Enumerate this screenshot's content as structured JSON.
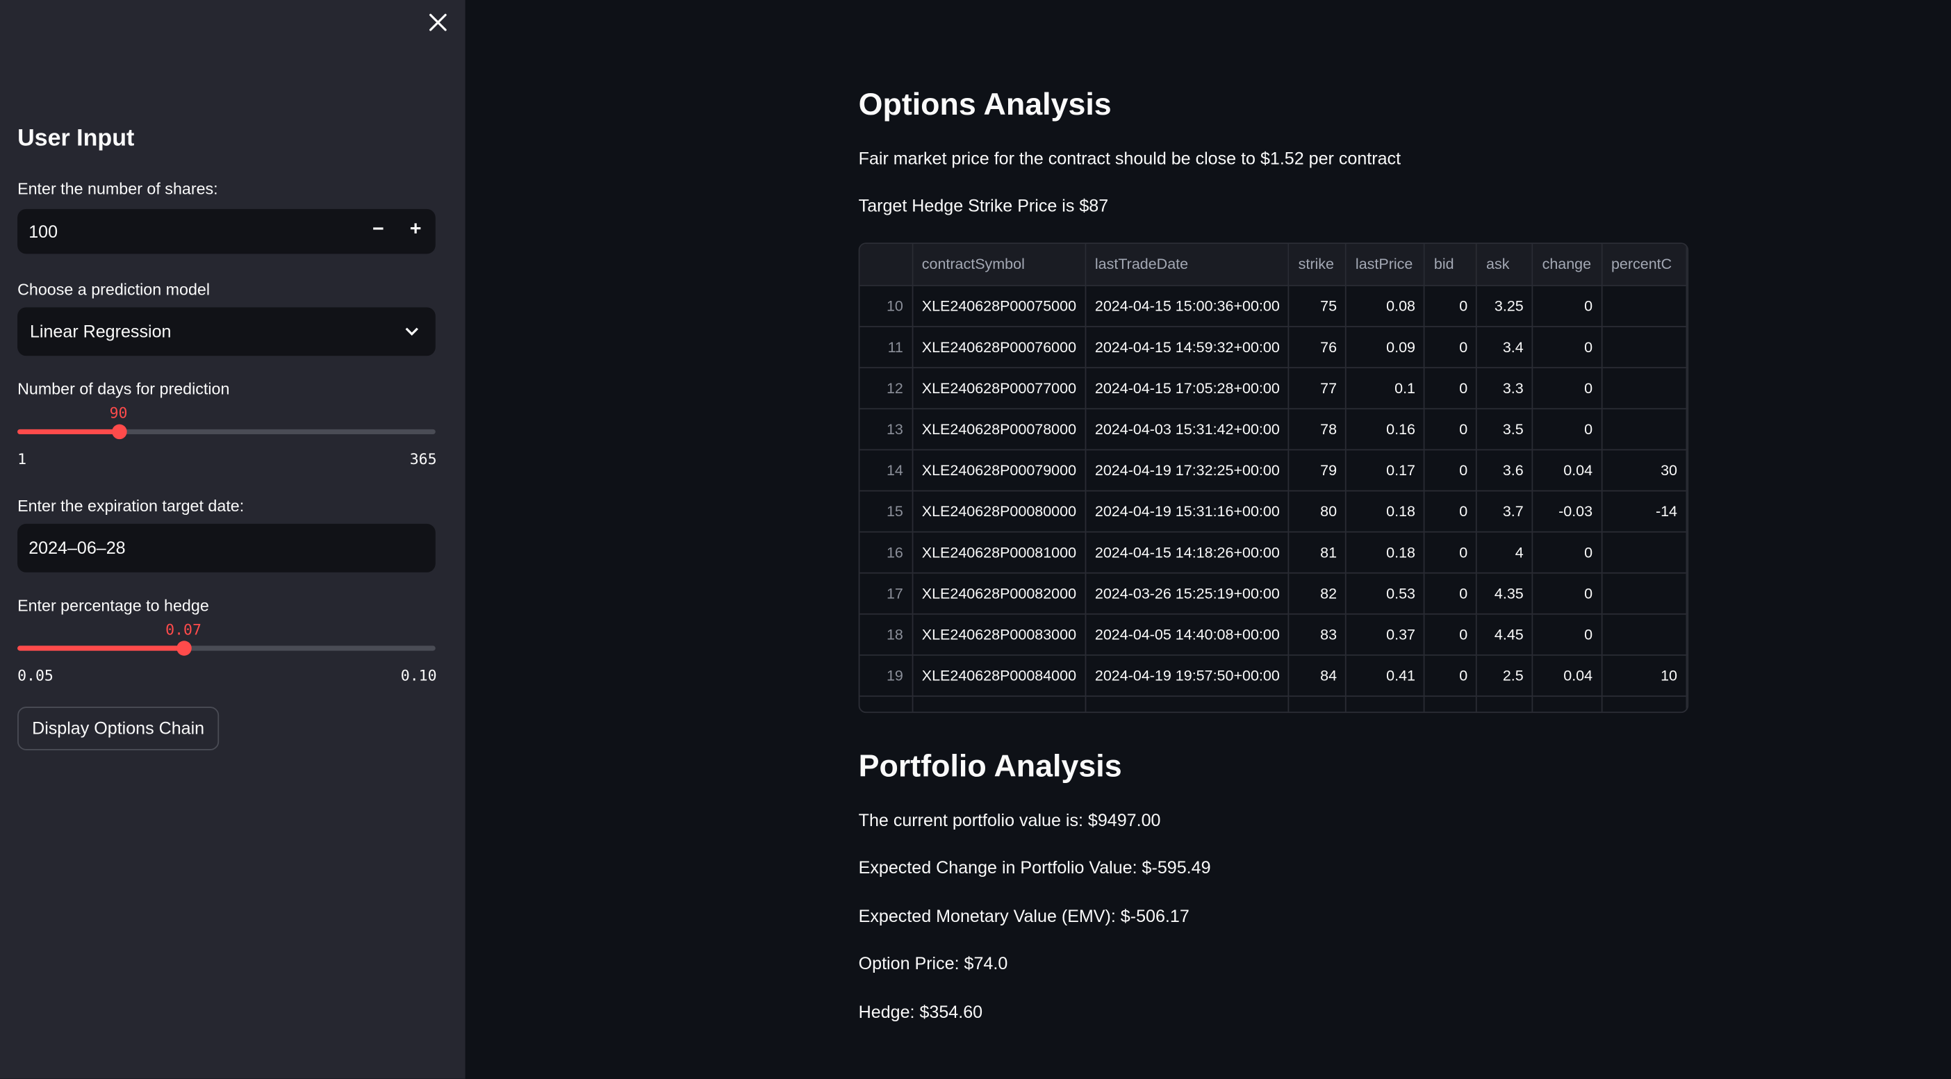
{
  "sidebar": {
    "close_icon": "close-x-icon",
    "title": "User Input",
    "shares": {
      "label": "Enter the number of shares:",
      "value": "100",
      "minus": "−",
      "plus": "+"
    },
    "model": {
      "label": "Choose a prediction model",
      "value": "Linear Regression",
      "icon": "chevron-down-icon"
    },
    "days": {
      "label": "Number of days for prediction",
      "value": "90",
      "min": "1",
      "max": "365",
      "fraction": 0.245
    },
    "date": {
      "label": "Enter the expiration target date:",
      "value": "2024–06–28"
    },
    "hedge": {
      "label": "Enter percentage to hedge",
      "value": "0.07",
      "min": "0.05",
      "max": "0.10",
      "fraction": 0.4
    },
    "button": "Display Options Chain"
  },
  "main": {
    "options_title": "Options Analysis",
    "fair_price": "Fair market price for the contract should be close to $1.52 per contract",
    "strike_text": "Target Hedge Strike Price is $87",
    "table": {
      "columns": [
        "",
        "contractSymbol",
        "lastTradeDate",
        "strike",
        "lastPrice",
        "bid",
        "ask",
        "change",
        "percentC"
      ],
      "rows": [
        [
          "10",
          "XLE240628P00075000",
          "2024-04-15 15:00:36+00:00",
          "75",
          "0.08",
          "0",
          "3.25",
          "0",
          ""
        ],
        [
          "11",
          "XLE240628P00076000",
          "2024-04-15 14:59:32+00:00",
          "76",
          "0.09",
          "0",
          "3.4",
          "0",
          ""
        ],
        [
          "12",
          "XLE240628P00077000",
          "2024-04-15 17:05:28+00:00",
          "77",
          "0.1",
          "0",
          "3.3",
          "0",
          ""
        ],
        [
          "13",
          "XLE240628P00078000",
          "2024-04-03 15:31:42+00:00",
          "78",
          "0.16",
          "0",
          "3.5",
          "0",
          ""
        ],
        [
          "14",
          "XLE240628P00079000",
          "2024-04-19 17:32:25+00:00",
          "79",
          "0.17",
          "0",
          "3.6",
          "0.04",
          "30"
        ],
        [
          "15",
          "XLE240628P00080000",
          "2024-04-19 15:31:16+00:00",
          "80",
          "0.18",
          "0",
          "3.7",
          "-0.03",
          "-14"
        ],
        [
          "16",
          "XLE240628P00081000",
          "2024-04-15 14:18:26+00:00",
          "81",
          "0.18",
          "0",
          "4",
          "0",
          ""
        ],
        [
          "17",
          "XLE240628P00082000",
          "2024-03-26 15:25:19+00:00",
          "82",
          "0.53",
          "0",
          "4.35",
          "0",
          ""
        ],
        [
          "18",
          "XLE240628P00083000",
          "2024-04-05 14:40:08+00:00",
          "83",
          "0.37",
          "0",
          "4.45",
          "0",
          ""
        ],
        [
          "19",
          "XLE240628P00084000",
          "2024-04-19 19:57:50+00:00",
          "84",
          "0.41",
          "0",
          "2.5",
          "0.04",
          "10"
        ]
      ]
    },
    "portfolio_title": "Portfolio Analysis",
    "portfolio_lines": [
      "The current portfolio value is: $9497.00",
      "Expected Change in Portfolio Value: $-595.49",
      "Expected Monetary Value (EMV): $-506.17",
      "Option Price: $74.0",
      "Hedge: $354.60"
    ]
  },
  "colors": {
    "accent": "#ff4b4b",
    "sidebar_bg": "#262730",
    "main_bg": "#0e1117"
  }
}
